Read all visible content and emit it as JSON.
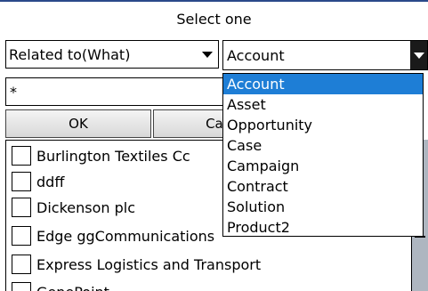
{
  "header": {
    "title": "Select one"
  },
  "related_select": {
    "value": "Related to(What)"
  },
  "object_combo": {
    "value": "Account"
  },
  "search": {
    "value": "*"
  },
  "buttons": {
    "ok": "OK",
    "cancel": "Car"
  },
  "records": [
    "Burlington Textiles Cc",
    "ddff",
    "Dickenson plc",
    "Edge ggCommunications",
    "Express Logistics and Transport",
    "GenePoint"
  ],
  "dropdown_options": [
    "Account",
    "Asset",
    "Opportunity",
    "Case",
    "Campaign",
    "Contract",
    "Solution",
    "Product2"
  ],
  "colors": {
    "selection": "#1e7ed6",
    "scrollbar": "#aeb6c0"
  }
}
